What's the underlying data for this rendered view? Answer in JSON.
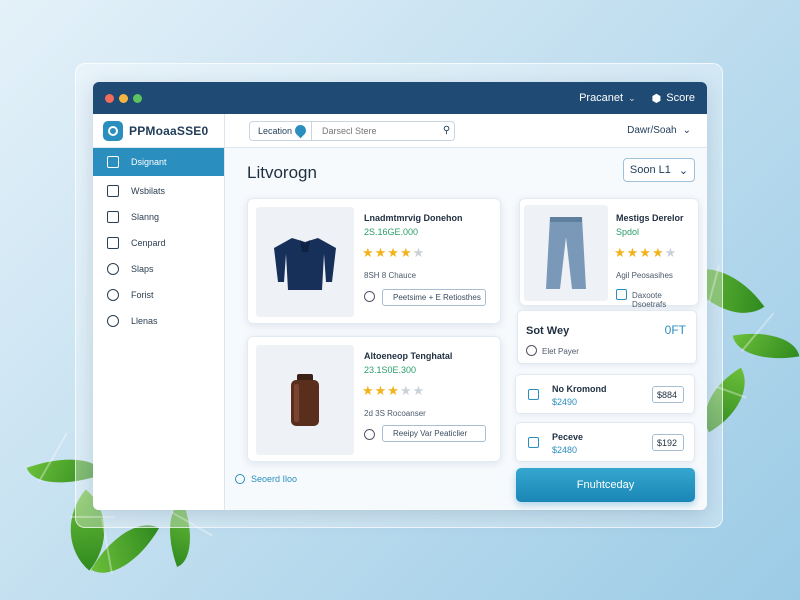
{
  "window": {
    "title_menu": "Pracanet",
    "title_action": "Score",
    "dots": [
      "#f26b5b",
      "#f5b641",
      "#5cc45f"
    ]
  },
  "brand": {
    "name": "PPMoaaSSE0"
  },
  "search": {
    "location": "Lecation",
    "placeholder": "Darsecl Stere"
  },
  "topbar": {
    "dropdown": "Dawr/Soah"
  },
  "sidebar": {
    "items": [
      {
        "label": "Dsignant",
        "icon": "grid-icon",
        "active": true
      },
      {
        "label": "Wsbilats",
        "icon": "book-icon"
      },
      {
        "label": "Slanng",
        "icon": "phone-icon"
      },
      {
        "label": "Cenpard",
        "icon": "columns-icon"
      },
      {
        "label": "Slaps",
        "icon": "clock-icon"
      },
      {
        "label": "Forist",
        "icon": "gear-icon"
      },
      {
        "label": "Llenas",
        "icon": "user-icon"
      }
    ]
  },
  "main": {
    "title": "Litvorogn",
    "sort_label": "Soon L1",
    "see_more": "Seoerd Iloo"
  },
  "products": [
    {
      "name": "Lnadmtmrvig Donehon",
      "price": "2S.16GE.000",
      "rating": 4,
      "meta": "8SH 8 Chauce",
      "action": "Peetsime + E Retiosthes"
    },
    {
      "name": "Altoeneop Tenghatal",
      "price": "23.1S0E.300",
      "rating": 3,
      "meta": "2d 3S Rocoanser",
      "action": "Reeipy Var Peaticlier"
    },
    {
      "name": "Mestigs Derelor",
      "price": "Spdol",
      "rating": 4,
      "meta": "Agil Peosasihes",
      "action": "Daxoote Dsoetrafs"
    }
  ],
  "panel": {
    "header": "Sot Wey",
    "header_value": "0FT",
    "option": "Elet Payer",
    "items": [
      {
        "name": "No Kromond",
        "price": "$2490",
        "value": "$884"
      },
      {
        "name": "Peceve",
        "price": "$2480",
        "value": "$192"
      }
    ],
    "cta": "Fnuhtceday"
  },
  "colors": {
    "titlebar": "#1f4a73",
    "accent": "#2a8fbf",
    "price_green": "#2a9d6a",
    "star": "#f2b31b"
  }
}
